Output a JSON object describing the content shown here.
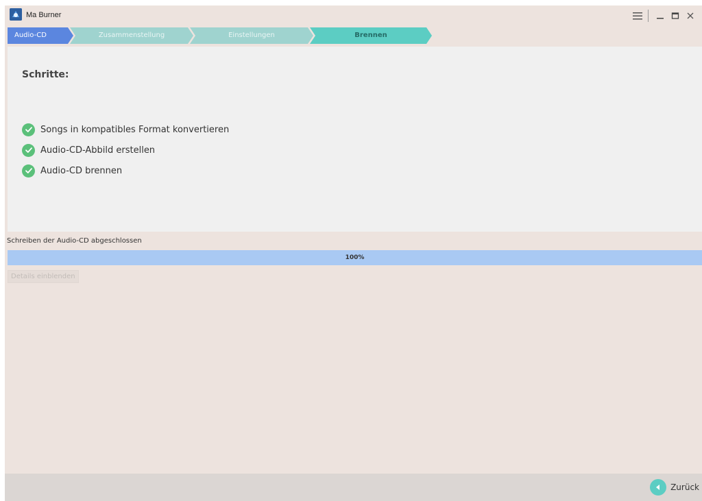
{
  "window": {
    "title": "Ma Burner",
    "icons": {
      "app": "app-logo-icon",
      "menu": "hamburger-menu-icon",
      "minimize": "minimize-icon",
      "maximize": "maximize-icon",
      "close": "close-icon"
    }
  },
  "wizard": {
    "steps": [
      {
        "label": "Audio-CD",
        "state": "done"
      },
      {
        "label": "Zusammenstellung",
        "state": "inactive"
      },
      {
        "label": "Einstellungen",
        "state": "inactive"
      },
      {
        "label": "Brennen",
        "state": "active"
      }
    ]
  },
  "main": {
    "heading": "Schritte:",
    "tasks": [
      {
        "label": "Songs in kompatibles Format konvertieren",
        "icon": "check-circle-icon",
        "status": "done"
      },
      {
        "label": "Audio-CD-Abbild erstellen",
        "icon": "check-circle-icon",
        "status": "done"
      },
      {
        "label": "Audio-CD brennen",
        "icon": "check-circle-icon",
        "status": "done"
      }
    ]
  },
  "progress": {
    "status_text": "Schreiben der Audio-CD abgeschlossen",
    "value": 1.0,
    "label": "100%"
  },
  "details_button": {
    "label": "Details einblenden"
  },
  "footer": {
    "back_label": "Zurück",
    "back_icon": "back-arrow-icon"
  },
  "colors": {
    "window_bg": "#ede3de",
    "panel_bg": "#f0f0f0",
    "step_done": "#5b86df",
    "step_inactive": "#9fd3cf",
    "step_active": "#5ccdc3",
    "check_green": "#5bc07a",
    "progress_fill": "#a9c9f3"
  }
}
